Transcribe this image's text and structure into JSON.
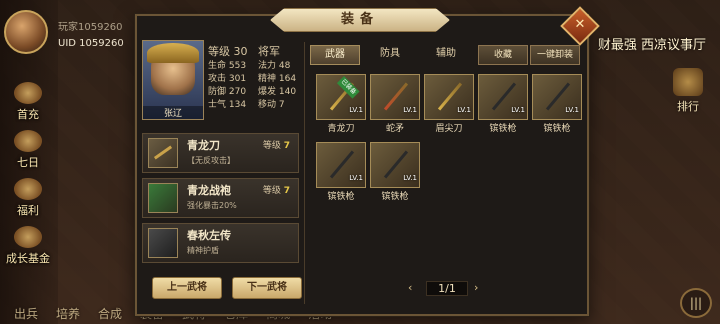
{
  "background": {
    "player_name": "玩家1059260",
    "player_uid": "UID  1059260",
    "side_menu": [
      "首充",
      "七日",
      "福利",
      "成长基金"
    ],
    "notice": "财最强 西凉议事厅",
    "rank_label": "排行",
    "bottom_menu": [
      "出兵",
      "培养",
      "合成",
      "装备",
      "武将",
      "仓库",
      "商城",
      "活动"
    ],
    "menu_icon": "menu-icon"
  },
  "panel": {
    "title": "装备",
    "close_icon": "close-x",
    "hero": {
      "name": "张辽",
      "level_label": "等级",
      "level": "30",
      "rank": "将军",
      "stats": [
        {
          "label": "生命",
          "value": "553",
          "label2": "法力",
          "value2": "48"
        },
        {
          "label": "攻击",
          "value": "301",
          "label2": "精神",
          "value2": "164"
        },
        {
          "label": "防御",
          "value": "270",
          "label2": "爆发",
          "value2": "140"
        },
        {
          "label": "士气",
          "value": "134",
          "label2": "移动",
          "value2": "7"
        }
      ]
    },
    "equipped": [
      {
        "name": "青龙刀",
        "level_label": "等级",
        "level": "7",
        "desc": "【无反攻击】"
      },
      {
        "name": "青龙战袍",
        "level_label": "等级",
        "level": "7",
        "desc": "强化暴击20%"
      },
      {
        "name": "春秋左传",
        "level_label": "",
        "level": "",
        "desc": "精神护盾"
      }
    ],
    "prev_button": "上一武将",
    "next_button": "下一武将",
    "tabs": [
      "武器",
      "防具",
      "辅助"
    ],
    "active_tab": "武器",
    "collect_button": "收藏",
    "unload_all_button": "一键卸装",
    "inventory": [
      {
        "name": "青龙刀",
        "lv": "LV.1",
        "tag": "已装备"
      },
      {
        "name": "蛇矛",
        "lv": "LV.1",
        "tag": ""
      },
      {
        "name": "眉尖刀",
        "lv": "LV.1",
        "tag": ""
      },
      {
        "name": "镔铁枪",
        "lv": "LV.1",
        "tag": ""
      },
      {
        "name": "镔铁枪",
        "lv": "LV.1",
        "tag": ""
      },
      {
        "name": "镔铁枪",
        "lv": "LV.1",
        "tag": ""
      },
      {
        "name": "镔铁枪",
        "lv": "LV.1",
        "tag": ""
      }
    ],
    "pager": {
      "text": "1/1",
      "prev": "‹",
      "next": "›"
    }
  }
}
